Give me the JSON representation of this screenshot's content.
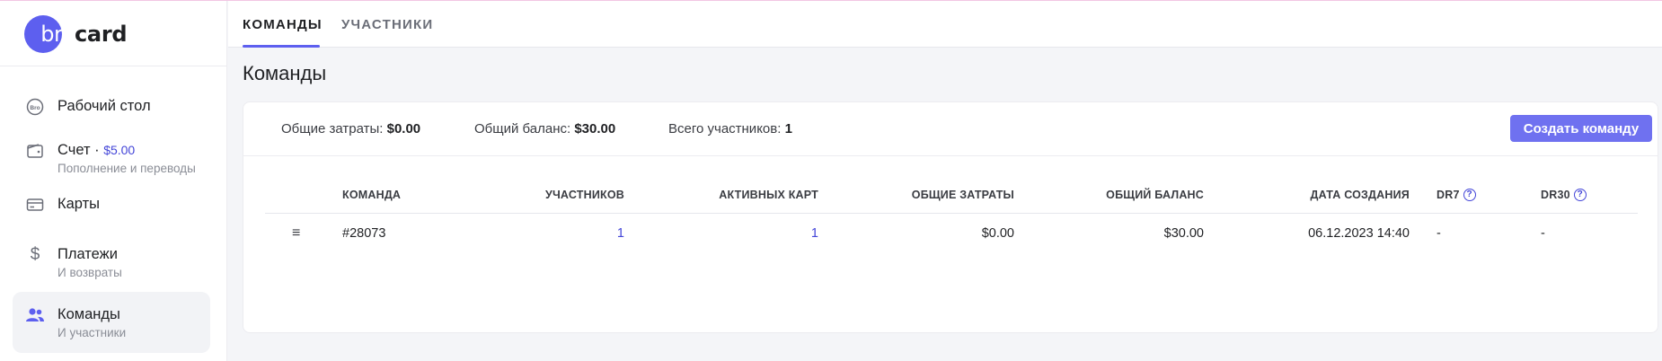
{
  "brand": {
    "part1": "bro",
    "part2": "card"
  },
  "sidebar": {
    "items": [
      {
        "label": "Рабочий стол",
        "sub": "",
        "icon": "bro-coin-icon"
      },
      {
        "label": "Счет · ",
        "amount": "$5.00",
        "sub": "Пополнение и переводы",
        "icon": "wallet-icon"
      },
      {
        "label": "Карты",
        "sub": "",
        "icon": "card-icon"
      },
      {
        "label": "Платежи",
        "sub": "И возвраты",
        "icon": "dollar-icon"
      },
      {
        "label": "Команды",
        "sub": "И участники",
        "icon": "users-icon",
        "active": true
      }
    ],
    "coin_glyph": "Bro"
  },
  "tabs": [
    {
      "label": "КОМАНДЫ",
      "active": true
    },
    {
      "label": "УЧАСТНИКИ",
      "active": false
    }
  ],
  "page": {
    "title": "Команды"
  },
  "stats": {
    "total_spent_label": "Общие затраты:",
    "total_spent_value": "$0.00",
    "total_balance_label": "Общий баланс:",
    "total_balance_value": "$30.00",
    "members_label": "Всего участников:",
    "members_value": "1"
  },
  "create_button": "Создать команду",
  "table": {
    "headers": {
      "team": "КОМАНДА",
      "members": "УЧАСТНИКОВ",
      "active_cards": "АКТИВНЫХ КАРТ",
      "total_spent": "ОБЩИЕ ЗАТРАТЫ",
      "total_balance": "ОБЩИЙ БАЛАНС",
      "created": "ДАТА СОЗДАНИЯ",
      "dr7": "DR7",
      "dr30": "DR30",
      "help_glyph": "?"
    },
    "rows": [
      {
        "menu": "≡",
        "team": "#28073",
        "members": "1",
        "active_cards": "1",
        "total_spent": "$0.00",
        "total_balance": "$30.00",
        "created": "06.12.2023 14:40",
        "dr7": "-",
        "dr30": "-"
      }
    ]
  },
  "colors": {
    "accent": "#5d5fef",
    "button": "#6f71f0",
    "link": "#4446d8"
  }
}
